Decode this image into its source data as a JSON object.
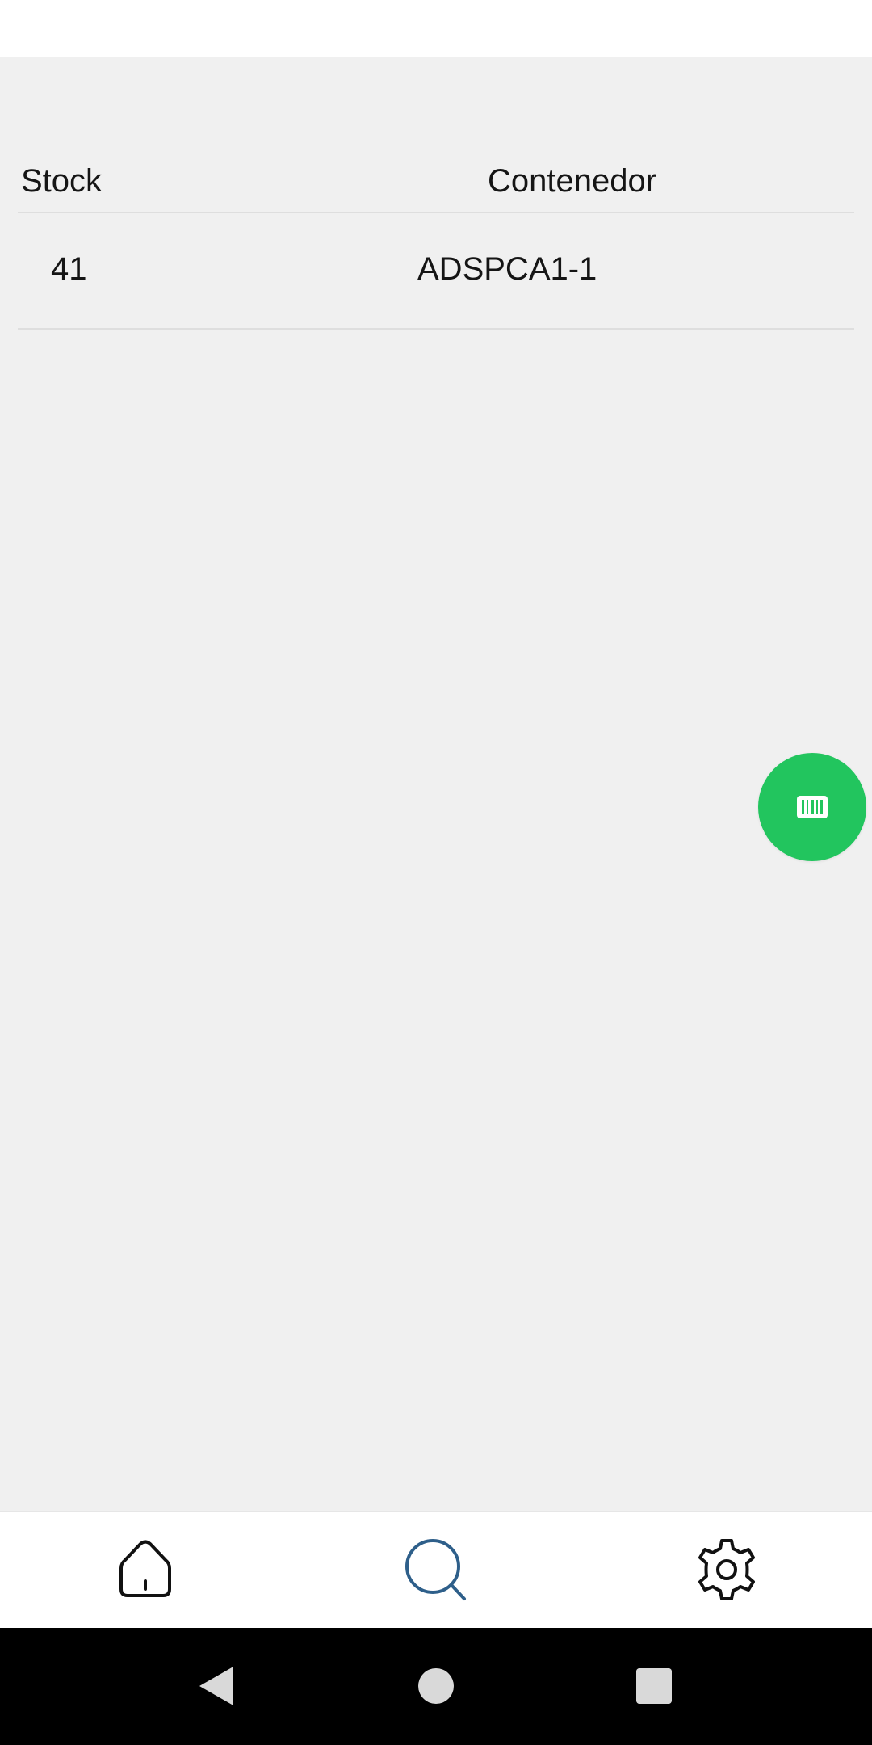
{
  "table": {
    "headers": {
      "stock": "Stock",
      "container": "Contenedor"
    },
    "rows": [
      {
        "stock": "41",
        "container": "ADSPCA1-1"
      }
    ]
  },
  "fab": {
    "icon": "barcode-icon",
    "color": "#22c55e"
  },
  "bottom_nav": {
    "items": [
      {
        "icon": "home-icon",
        "active": false
      },
      {
        "icon": "search-icon",
        "active": true,
        "color": "#2e5f8a"
      },
      {
        "icon": "gear-icon",
        "active": false
      }
    ]
  },
  "system_nav": {
    "items": [
      {
        "icon": "back-triangle-icon"
      },
      {
        "icon": "home-circle-icon"
      },
      {
        "icon": "recents-square-icon"
      }
    ]
  }
}
